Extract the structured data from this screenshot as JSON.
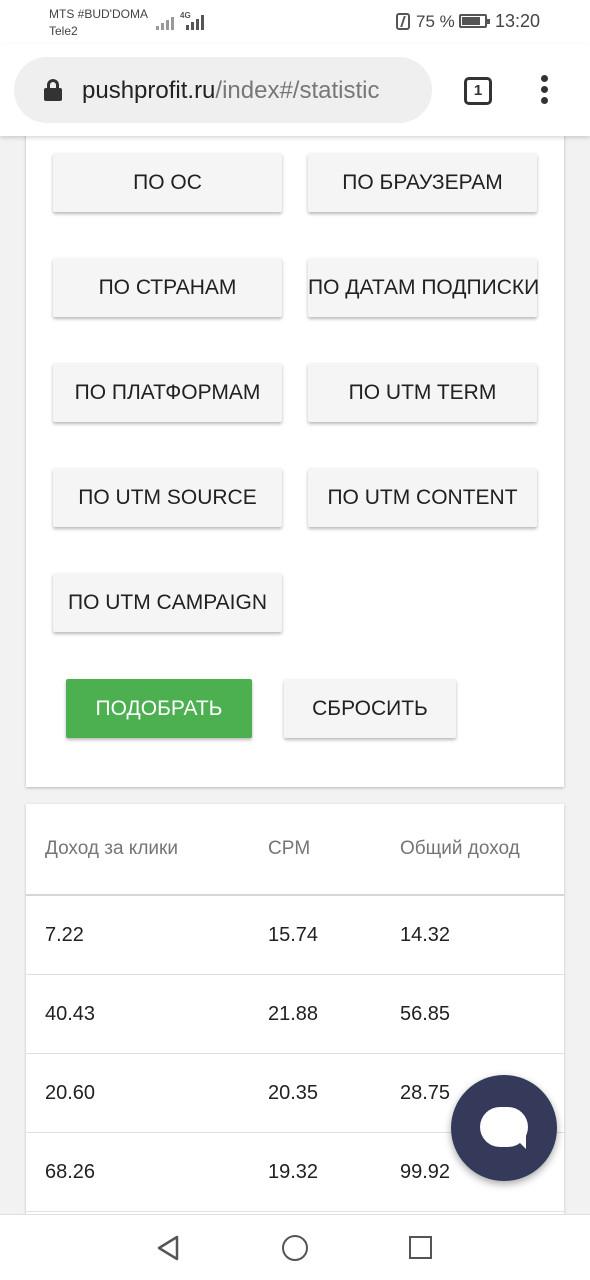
{
  "status_bar": {
    "carrier_primary": "MTS #BUD'DOMA",
    "carrier_secondary": "Tele2",
    "network_type": "4G",
    "battery_percent": "75 %",
    "time": "13:20"
  },
  "browser": {
    "url_domain": "pushprofit.ru",
    "url_path": "/index#/statistic",
    "tab_count": "1"
  },
  "filters": {
    "buttons": [
      {
        "label": "ПО ОС"
      },
      {
        "label": "ПО БРАУЗЕРАМ"
      },
      {
        "label": "ПО СТРАНАМ"
      },
      {
        "label": "ПО ДАТАМ ПОДПИСКИ"
      },
      {
        "label": "ПО ПЛАТФОРМАМ"
      },
      {
        "label": "ПО UTM TERM"
      },
      {
        "label": "ПО UTM SOURCE"
      },
      {
        "label": "ПО UTM CONTENT"
      },
      {
        "label": "ПО UTM CAMPAIGN"
      }
    ],
    "apply_label": "ПОДОБРАТЬ",
    "reset_label": "СБРОСИТЬ",
    "apply_color": "#4caf50"
  },
  "stats_table": {
    "columns": [
      "Доход за клики",
      "CPM",
      "Общий доход"
    ],
    "rows": [
      [
        "7.22",
        "15.74",
        "14.32"
      ],
      [
        "40.43",
        "21.88",
        "56.85"
      ],
      [
        "20.60",
        "20.35",
        "28.75"
      ],
      [
        "68.26",
        "19.32",
        "99.92"
      ]
    ]
  },
  "chat_widget": {
    "icon": "chat-bubble-icon",
    "color": "#363a5a"
  },
  "nav_bar": {
    "icons": [
      "back-icon",
      "home-icon",
      "recent-apps-icon"
    ]
  }
}
